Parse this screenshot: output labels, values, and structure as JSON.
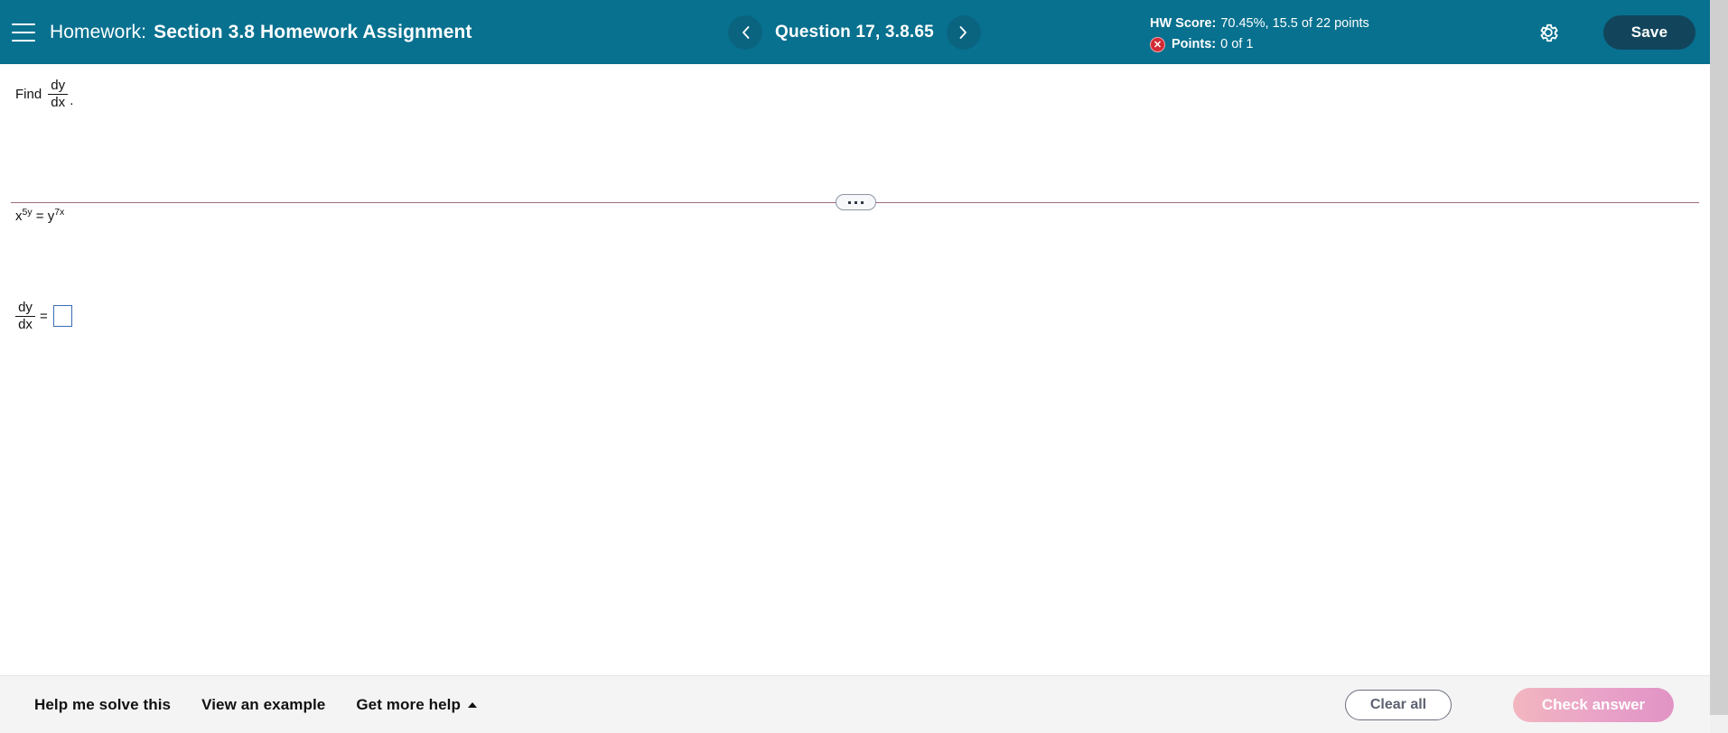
{
  "header": {
    "menu_icon": "hamburger-icon",
    "context_label": "Homework:",
    "assignment_title": "Section 3.8 Homework Assignment",
    "prev_icon": "chevron-left-icon",
    "next_icon": "chevron-right-icon",
    "question_label": "Question 17, 3.8.65",
    "hw_score_label": "HW Score:",
    "hw_score_value": "70.45%, 15.5 of 22 points",
    "points_label": "Points:",
    "points_value": "0 of 1",
    "points_status_icon": "x-circle-icon",
    "settings_icon": "gear-icon",
    "save_label": "Save",
    "bg_color": "#07718f",
    "save_bg_color": "#12455c",
    "status_icon_color": "#d32a35"
  },
  "problem": {
    "prompt_word": "Find",
    "prompt_frac_num": "dy",
    "prompt_frac_den": "dx",
    "prompt_period": ".",
    "equation_lhs_base": "x",
    "equation_lhs_exp": "5y",
    "equation_operator": "=",
    "equation_rhs_base": "y",
    "equation_rhs_exp": "7x",
    "equation_plain": "x^(5y) = y^(7x)"
  },
  "divider": {
    "handle_icon": "drag-handle-dots-icon",
    "line_color": "#a0697e"
  },
  "answer": {
    "frac_num": "dy",
    "frac_den": "dx",
    "equals": "=",
    "input_value": "",
    "input_placeholder": "",
    "input_border_color": "#3b6cb8"
  },
  "footer": {
    "help_me_solve_this": "Help me solve this",
    "view_an_example": "View an example",
    "get_more_help": "Get more help",
    "get_more_help_icon": "caret-up-icon",
    "clear_all": "Clear all",
    "check_answer": "Check answer",
    "check_answer_enabled": false,
    "bg_color": "#f4f4f5"
  }
}
